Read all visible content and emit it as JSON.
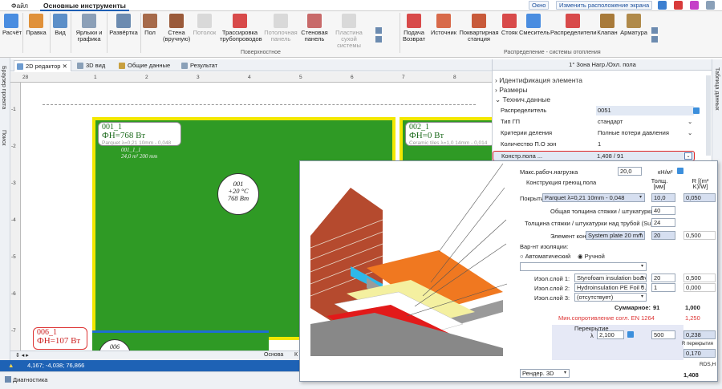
{
  "menu": {
    "file": "Файл",
    "main_tools": "Основные инструменты"
  },
  "top_right": {
    "window": "Окно",
    "layout": "Изменить расположение экрана"
  },
  "ribbon": {
    "buttons": [
      "Расчёт",
      "Правка",
      "Вид",
      "Ярлыки и графика",
      "Развёртка",
      "Пол",
      "Стена (вручную)",
      "Потолок",
      "Трассировка трубопроводов",
      "Потолочная панель",
      "Стеновая панель",
      "Пластина сухой системы",
      "Подача Возврат",
      "Источник",
      "Поквартирная станция",
      "Стояк",
      "Смеситель",
      "Распределители",
      "Клапан",
      "Арматура"
    ],
    "group_surface": "Поверхностное",
    "group_heating": "Распределение - системы отопления"
  },
  "left_strip": {
    "browser": "Браузер проекта",
    "search": "Поиск"
  },
  "right_strip": {
    "table": "Таблица данных"
  },
  "tabs": {
    "editor2d": "2D редактор",
    "view3d": "3D вид",
    "common": "Общие данные",
    "result": "Результат"
  },
  "ruler": {
    "ticks": [
      "28",
      "1",
      "2",
      "3",
      "4",
      "5",
      "6",
      "7",
      "8"
    ],
    "left_ticks": [
      "-1",
      "-2",
      "-3",
      "-4",
      "-5",
      "-6",
      "-7"
    ]
  },
  "rooms": {
    "r1": {
      "name": "001_1",
      "power": "ФН=768 Вт",
      "detail": "Parquet λ=0,21 10mm - 0,048",
      "sub1": "001_1_1",
      "sub2": "24,0 m² 200 mm",
      "circle": [
        "001",
        "+20 °C",
        "768 Вт"
      ]
    },
    "r2": {
      "name": "002_1",
      "power": "ФН=0 Вт",
      "detail": "Ceramic tiles λ=1,0 14mm - 0,014",
      "sub1": "002_1_1"
    },
    "r3": {
      "name": "006_1",
      "power": "ФН=107 Вт",
      "circle": "006"
    }
  },
  "statusbar": {
    "basis": "Основа",
    "k": "К"
  },
  "bluebar": {
    "coords": "4,167; -4,038; 76,866"
  },
  "diagnostics": "Диагностика",
  "props": {
    "header": "1° Зона Нагр./Охл. пола",
    "sections": [
      "Идентификация элемента",
      "Размеры",
      "Технич.данные"
    ],
    "rows": [
      {
        "k": "Распределитель",
        "v": "0051"
      },
      {
        "k": "Тип ГП",
        "v": "стандарт"
      },
      {
        "k": "Критерии деления",
        "v": "Полные потери давления"
      },
      {
        "k": "Количество П.О зон",
        "v": "1"
      },
      {
        "k": "Констр.пола ...",
        "v": "1,408 / 91"
      }
    ]
  },
  "popup": {
    "max_load_label": "Макс.рабоч.нагрузка",
    "max_load": "20,0",
    "max_load_unit": "кН/м²",
    "construction": "Конструкция греющ.пола",
    "col_thick": "Толщ. [мм]",
    "col_r": "R [(m² K)/W]",
    "cover_label": "Покрытие",
    "cover": "Parquet λ=0,21 10mm - 0,048",
    "cover_thick": "10,0",
    "cover_r": "0,050",
    "screed_total_label": "Общая толщина стяжки / штукатурки:",
    "screed_total": "40",
    "screed_over_label": "Толщина стяжки / штукатурки над трубой (Su):",
    "screed_over": "24",
    "element_label": "Элемент констр.",
    "element": "System plate 20 mm",
    "element_thick": "20",
    "element_r": "0,500",
    "ins_variant": "Вар-нт изоляции:",
    "auto": "Автоматический",
    "manual": "Ручной",
    "layers": [
      {
        "k": "Изол.слой 1:",
        "v": "Styrofoam insulation board",
        "t": "20",
        "r": "0,500"
      },
      {
        "k": "Изол.слой 2:",
        "v": "Hydroinsulation PE Foil 0.2 m",
        "t": "1",
        "r": "0,000"
      },
      {
        "k": "Изол.слой 3:",
        "v": "(отсутствует)",
        "t": "",
        "r": ""
      }
    ],
    "sum_label": "Суммарное:",
    "sum_thick": "91",
    "sum_r": "1,000",
    "min_res_label": "Мин.сопротивление согл. EN 1264",
    "min_res": "1,250",
    "slab_label": "Перекрытие",
    "lambda_sym": "λ",
    "slab_lambda": "2,100",
    "slab_thick": "500",
    "slab_r": "0,238",
    "r_slab_label": "R перекрытия",
    "r_slab": "0,170",
    "rds_label": "RDS,H",
    "rds": "1,408",
    "render": "Рендер. 3D"
  }
}
